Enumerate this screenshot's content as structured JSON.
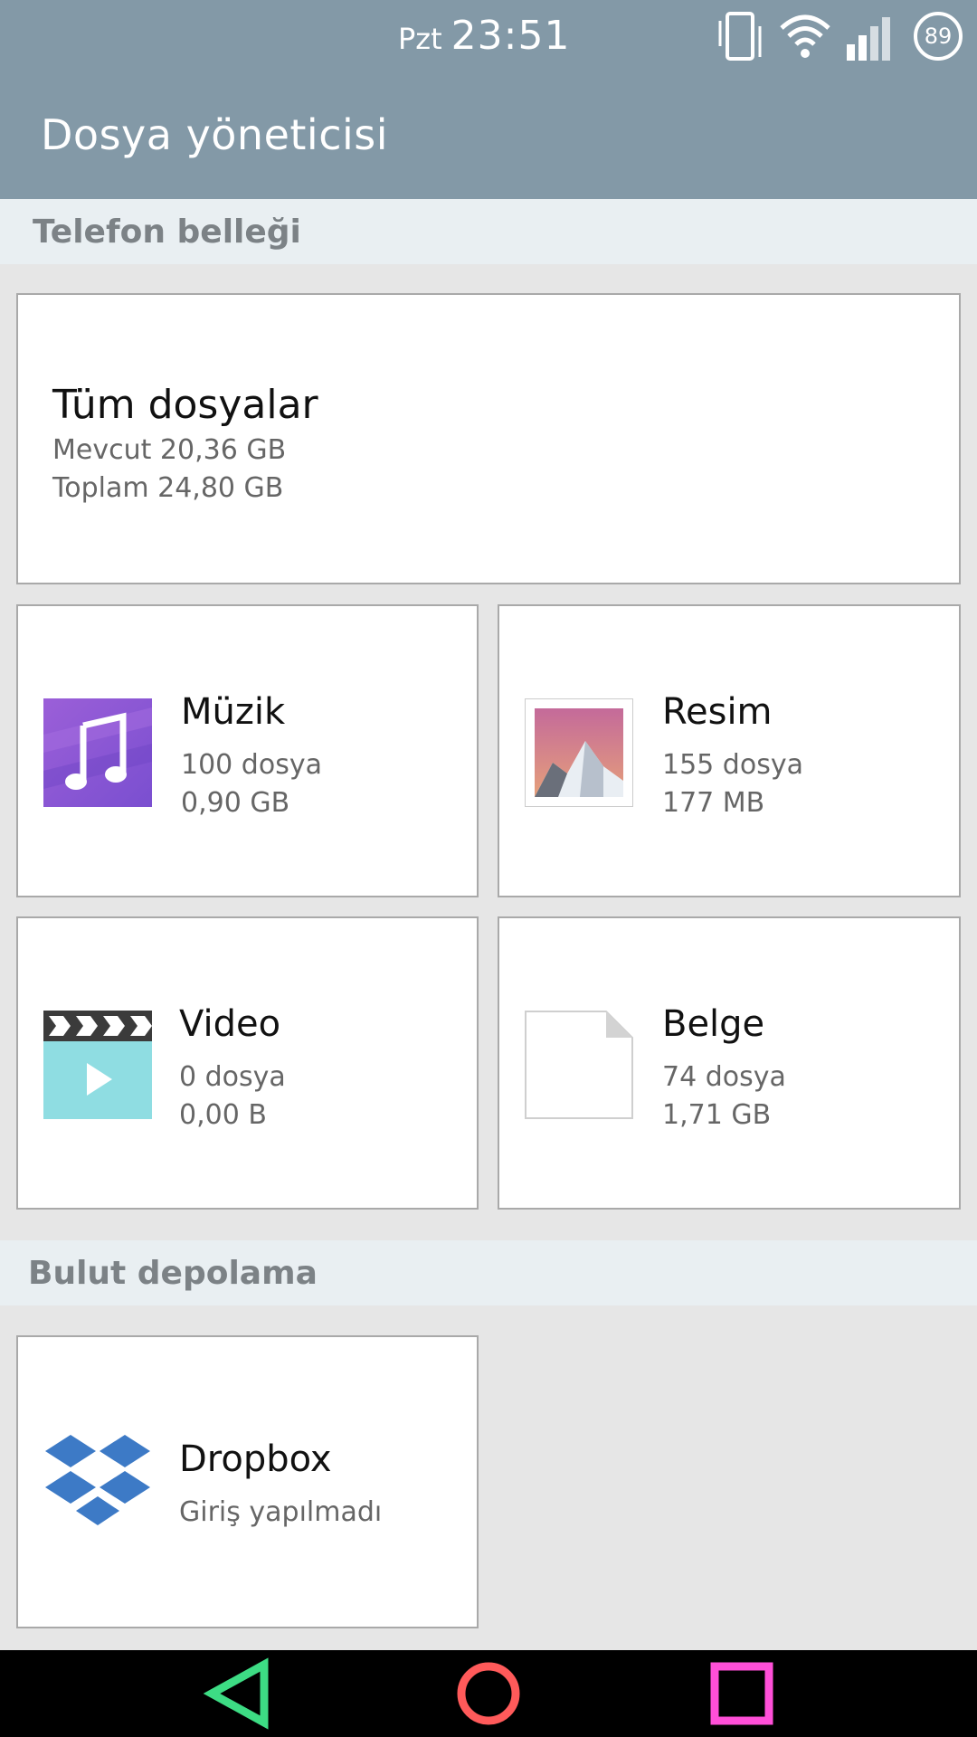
{
  "status_bar": {
    "day": "Pzt",
    "time": "23:51",
    "battery": "89"
  },
  "app_bar": {
    "title": "Dosya yöneticisi"
  },
  "sections": {
    "phone": {
      "header": "Telefon belleği"
    },
    "cloud": {
      "header": "Bulut depolama"
    }
  },
  "all_files": {
    "title": "Tüm dosyalar",
    "available": "Mevcut 20,36 GB",
    "total": "Toplam 24,80 GB"
  },
  "categories": [
    {
      "title": "Müzik",
      "count": "100 dosya",
      "size": "0,90 GB",
      "icon": "music-icon"
    },
    {
      "title": "Resim",
      "count": "155 dosya",
      "size": "177 MB",
      "icon": "image-icon"
    },
    {
      "title": "Video",
      "count": "0 dosya",
      "size": "0,00 B",
      "icon": "video-icon"
    },
    {
      "title": "Belge",
      "count": "74 dosya",
      "size": "1,71 GB",
      "icon": "document-icon"
    }
  ],
  "cloud_services": [
    {
      "title": "Dropbox",
      "status": "Giriş yapılmadı",
      "icon": "dropbox-icon"
    }
  ],
  "colors": {
    "app_bar": "#8399a7",
    "nav_back": "#3ddc84",
    "nav_home": "#ff5a5a",
    "nav_recent": "#ff4fd8",
    "dropbox": "#3d7ac6",
    "music": "#8b55d6",
    "video": "#8fdde2"
  }
}
